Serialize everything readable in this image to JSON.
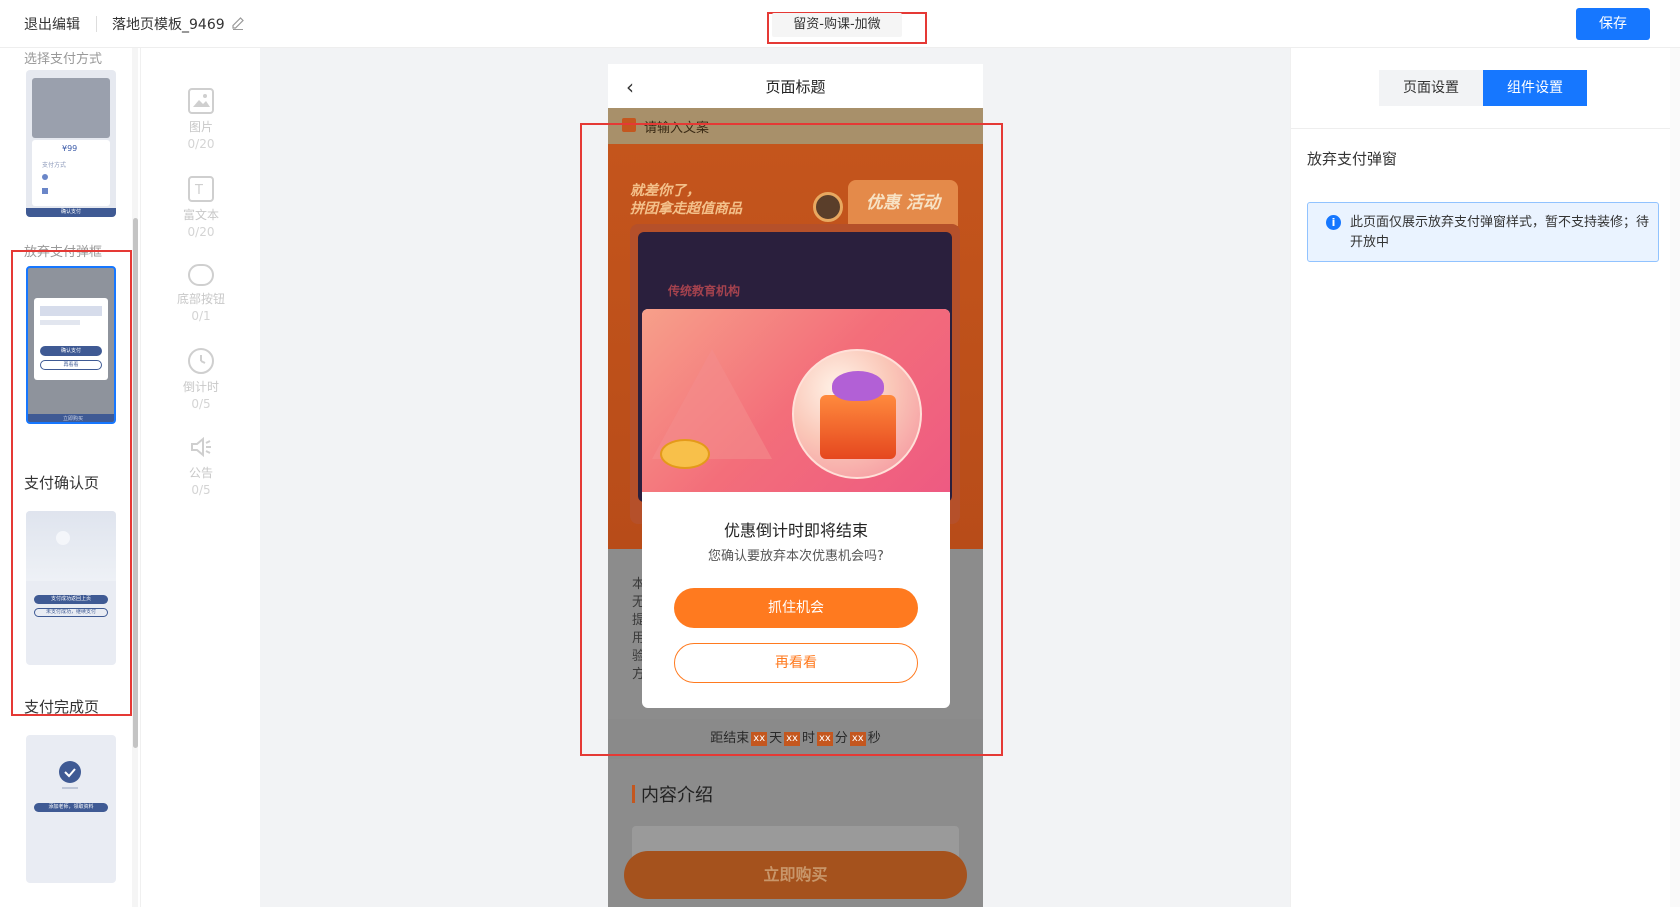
{
  "topbar": {
    "exit_label": "退出编辑",
    "template_name": "落地页模板_9469",
    "center_title": "留资-购课-加微",
    "save_label": "保存"
  },
  "page_list": {
    "items": [
      {
        "label": "选择支付方式"
      },
      {
        "label": "放弃支付弹框"
      },
      {
        "label": "支付确认页"
      },
      {
        "label": "支付完成页"
      }
    ],
    "thumb1": {
      "price": "¥99",
      "method": "支付方式",
      "pay": "确认支付"
    },
    "thumb2": {
      "confirm": "确认支付",
      "again": "再看看",
      "bottom": "立即购买"
    },
    "thumb3": {
      "btn1": "支付成功返回上页",
      "btn2": "未支付成功，继续支付"
    },
    "thumb4": {
      "btn": "添加老师，领取资料"
    }
  },
  "components": [
    {
      "label": "图片",
      "count": "0/20",
      "icon": "image-icon"
    },
    {
      "label": "富文本",
      "count": "0/20",
      "icon": "richtext-icon"
    },
    {
      "label": "底部按钮",
      "count": "0/1",
      "icon": "bottom-button-icon"
    },
    {
      "label": "倒计时",
      "count": "0/5",
      "icon": "timer-icon"
    },
    {
      "label": "公告",
      "count": "0/5",
      "icon": "speaker-icon"
    }
  ],
  "phone": {
    "title": "页面标题",
    "notice": "请输入文案",
    "slogan_line1": "就差你了，",
    "slogan_line2": "拼团拿走超值商品",
    "activity_tag": "优惠 活动",
    "card_subtitle": "传统教育机构",
    "desc_chars": [
      "本",
      "无",
      "提",
      "用",
      "验",
      "方"
    ],
    "countdown": {
      "prefix": "距结束",
      "box": "xx",
      "day": "天",
      "hour": "时",
      "min": "分",
      "sec": "秒"
    },
    "content_title": "内容介绍",
    "buy_label": "立即购买"
  },
  "modal": {
    "title": "优惠倒计时即将结束",
    "subtitle": "您确认要放弃本次优惠机会吗?",
    "primary_label": "抓住机会",
    "secondary_label": "再看看"
  },
  "right_panel": {
    "tabs": [
      {
        "label": "页面设置"
      },
      {
        "label": "组件设置"
      }
    ],
    "section_title": "放弃支付弹窗",
    "info_text": "此页面仅展示放弃支付弹窗样式，暂不支持装修；待开放中"
  },
  "colors": {
    "accent": "#1677ff",
    "orange": "#ff7a1f",
    "highlight_red": "#e53935"
  }
}
